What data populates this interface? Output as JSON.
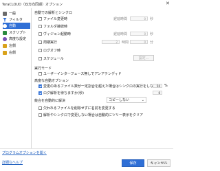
{
  "window": {
    "title": "TeraCLOUD（双方向同期）オプション",
    "close_glyph": "✕"
  },
  "sidebar": {
    "items": [
      {
        "label": "一般",
        "icon": "sliders-icon",
        "color": "#6b6b6b"
      },
      {
        "label": "フィルタ",
        "icon": "filter-icon",
        "color": "#2f6fd6"
      },
      {
        "label": "自動",
        "icon": "clock-icon",
        "color": "#2f6fd6",
        "selected": true
      },
      {
        "label": "スクリプト",
        "icon": "script-icon",
        "color": "#2b8a3e"
      },
      {
        "label": "高度な設定",
        "icon": "gear-icon",
        "color": "#7a4fb5"
      },
      {
        "label": "左側",
        "icon": "folder-icon",
        "color": "#d9a21b"
      },
      {
        "label": "右側",
        "icon": "folder-icon",
        "color": "#d9a21b"
      }
    ]
  },
  "auto_parse_group": {
    "label": "自動での解析とシンクロ",
    "options": [
      {
        "label": "ファイル変更時",
        "checked": false,
        "delay_label": "遅延時間",
        "value": "0",
        "unit": "秒"
      },
      {
        "label": "フォルダ接続時",
        "checked": false
      },
      {
        "label": "ヴィジョン起動時",
        "checked": false,
        "delay_label": "遅延時間",
        "value": "0",
        "unit": "秒"
      },
      {
        "label": "周期実行",
        "checked": false,
        "value": "2",
        "interval_unit": "時間",
        "value2": "0",
        "unit": "分"
      },
      {
        "label": "ログオフ時",
        "checked": false
      },
      {
        "label": "スケジュール",
        "checked": false,
        "button": "設定..."
      }
    ]
  },
  "exec_mode": {
    "label": "実行モード",
    "option": {
      "label": "ユーザーインターフェース無しでアンアテンディド",
      "checked": false
    }
  },
  "advanced_options": {
    "label": "高度な自動オプション",
    "change_threshold": {
      "label": "変更のあるファイル数が一定割合を超えた場合はシンクロの実行をしない",
      "checked": true,
      "value": "50",
      "unit": "%"
    },
    "log_failure": {
      "label": "ログ解析を待ちますか(秒)",
      "checked": true,
      "value": "0"
    },
    "conflict": {
      "label": "競合を自動的に解決",
      "value": "コピーしない"
    },
    "missing": {
      "label": "欠われるファイルを削除せずに名前を変更する",
      "checked": false
    },
    "sync_conflict": {
      "label": "解析やシンクロで変更しない場合は自動的にツリー表示をクリア",
      "checked": false
    }
  },
  "footer": {
    "program_options_link": "プログラムオプションを開く",
    "help_link": "詳細なヘルプ",
    "save": "保存",
    "cancel": "キャンセル"
  }
}
